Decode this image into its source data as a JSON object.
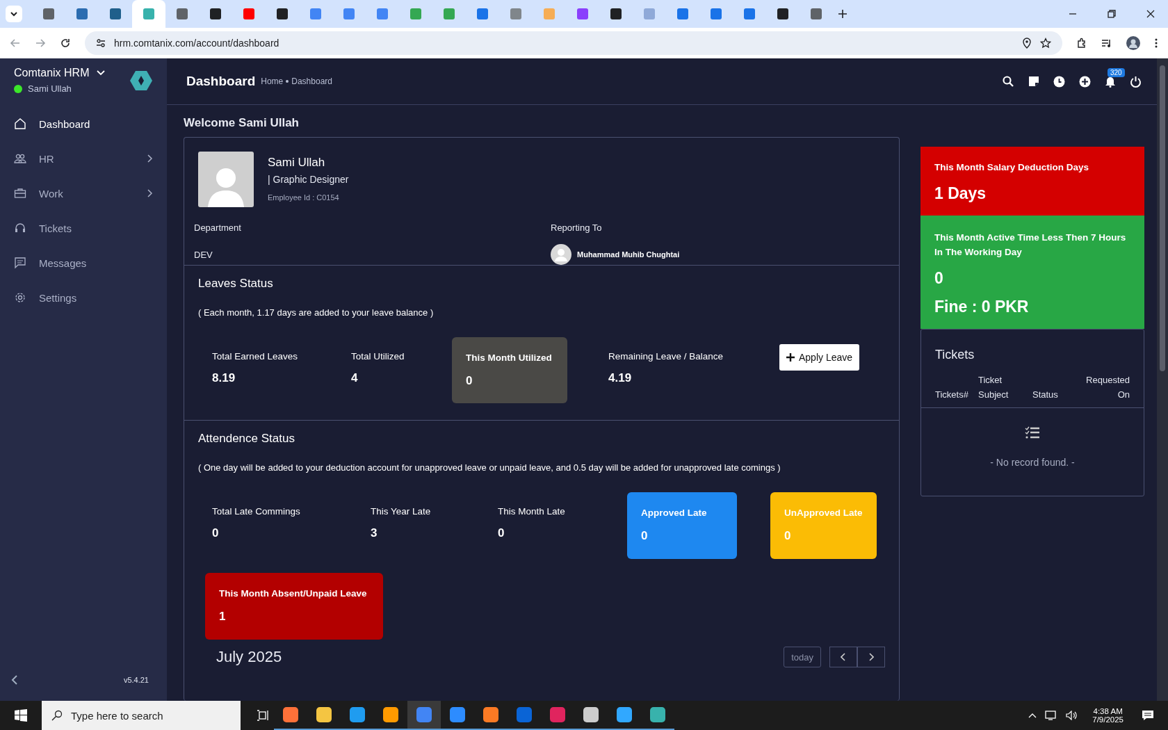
{
  "browser": {
    "tabs": [
      {
        "selected": false,
        "color": "#5f6368"
      },
      {
        "selected": false,
        "color": "#2b6cb0"
      },
      {
        "selected": false,
        "color": "#1f5f8b"
      },
      {
        "selected": true,
        "color": "#38b2ac"
      },
      {
        "selected": false,
        "color": "#5f6368"
      },
      {
        "selected": false,
        "color": "#202124"
      },
      {
        "selected": false,
        "color": "#ff0000"
      },
      {
        "selected": false,
        "color": "#202124"
      },
      {
        "selected": false,
        "color": "#4285f4"
      },
      {
        "selected": false,
        "color": "#4285f4"
      },
      {
        "selected": false,
        "color": "#4285f4"
      },
      {
        "selected": false,
        "color": "#34a853"
      },
      {
        "selected": false,
        "color": "#34a853"
      },
      {
        "selected": false,
        "color": "#1a73e8"
      },
      {
        "selected": false,
        "color": "#80868b"
      },
      {
        "selected": false,
        "color": "#f6ad55"
      },
      {
        "selected": false,
        "color": "#8a3ffc"
      },
      {
        "selected": false,
        "color": "#202124"
      },
      {
        "selected": false,
        "color": "#8fa9d8"
      },
      {
        "selected": false,
        "color": "#1a73e8"
      },
      {
        "selected": false,
        "color": "#1a73e8"
      },
      {
        "selected": false,
        "color": "#1a73e8"
      },
      {
        "selected": false,
        "color": "#202124"
      },
      {
        "selected": false,
        "color": "#5f6368"
      }
    ],
    "address": "hrm.comtanix.com/account/dashboard"
  },
  "sidebar": {
    "brand": "Comtanix HRM",
    "user": "Sami Ullah",
    "online": true,
    "items": [
      {
        "label": "Dashboard",
        "selected": true,
        "has_submenu": false
      },
      {
        "label": "HR",
        "selected": false,
        "has_submenu": true
      },
      {
        "label": "Work",
        "selected": false,
        "has_submenu": true
      },
      {
        "label": "Tickets",
        "selected": false,
        "has_submenu": false
      },
      {
        "label": "Messages",
        "selected": false,
        "has_submenu": false
      },
      {
        "label": "Settings",
        "selected": false,
        "has_submenu": false
      }
    ],
    "version": "v5.4.21"
  },
  "header": {
    "title": "Dashboard",
    "breadcrumb": [
      "Home",
      "Dashboard"
    ],
    "notification_count": "320"
  },
  "welcome": "Welcome Sami Ullah",
  "profile": {
    "name": "Sami Ullah",
    "role": "| Graphic Designer",
    "employee_id": "Employee Id : C0154",
    "department_label": "Department",
    "department": "DEV",
    "reporting_label": "Reporting To",
    "reporting_to": "Muhammad Muhib Chughtai"
  },
  "leaves": {
    "title": "Leaves Status",
    "note": "( Each month, 1.17 days are added to your leave balance )",
    "stats": [
      {
        "kind": "plain",
        "label": "Total Earned Leaves",
        "value": "8.19"
      },
      {
        "kind": "plain",
        "label": "Total Utilized",
        "value": "4"
      },
      {
        "kind": "tile",
        "label": "This Month Utilized",
        "value": "0",
        "color": "#4a4946"
      },
      {
        "kind": "plain",
        "label": "Remaining Leave / Balance",
        "value": "4.19"
      }
    ],
    "button": "Apply Leave"
  },
  "attendance": {
    "title": "Attendence Status",
    "note": "( One day will be added to your deduction account for unapproved leave or unpaid leave, and 0.5 day will be added for unapproved late comings )",
    "stats": [
      {
        "kind": "plain",
        "label": "Total Late Commings",
        "value": "0"
      },
      {
        "kind": "plain",
        "label": "This Year Late",
        "value": "3"
      },
      {
        "kind": "plain",
        "label": "This Month Late",
        "value": "0"
      },
      {
        "kind": "tile",
        "label": "Approved Late",
        "value": "0",
        "color": "#1e88f0"
      },
      {
        "kind": "tile",
        "label": "UnApproved Late",
        "value": "0",
        "color": "#fbbc05"
      },
      {
        "kind": "tile",
        "label": "This Month Absent/Unpaid Leave",
        "value": "1",
        "color": "#b30000"
      }
    ]
  },
  "calendar": {
    "title": "July 2025",
    "today": "today"
  },
  "summary_cards": [
    {
      "label": "This Month Salary Deduction Days",
      "value": "1 Days",
      "color": "#d40000"
    },
    {
      "label": "This Month Active Time Less Then 7 Hours In The Working Day",
      "value": "0",
      "extra": "Fine : 0 PKR",
      "color": "#28a745"
    }
  ],
  "tickets": {
    "title": "Tickets",
    "columns": [
      "Tickets#",
      "Ticket Subject",
      "Status",
      "Requested On"
    ],
    "empty": "- No record found. -"
  },
  "taskbar": {
    "search_placeholder": "Type here to search",
    "apps": [
      {
        "color": "#ff7139",
        "selected": false
      },
      {
        "color": "#f4c542",
        "selected": false
      },
      {
        "color": "#1f9cf0",
        "selected": false
      },
      {
        "color": "#ff9a00",
        "selected": false
      },
      {
        "color": "#4285f4",
        "selected": true
      },
      {
        "color": "#2d8cff",
        "selected": false
      },
      {
        "color": "#fb7a24",
        "selected": false
      },
      {
        "color": "#0a64d6",
        "selected": false
      },
      {
        "color": "#e0245e",
        "selected": false
      },
      {
        "color": "#cccccc",
        "selected": false
      },
      {
        "color": "#31a8ff",
        "selected": false
      },
      {
        "color": "#38b2ac",
        "selected": false
      }
    ],
    "time": "4:38 AM",
    "date": "7/9/2025"
  }
}
